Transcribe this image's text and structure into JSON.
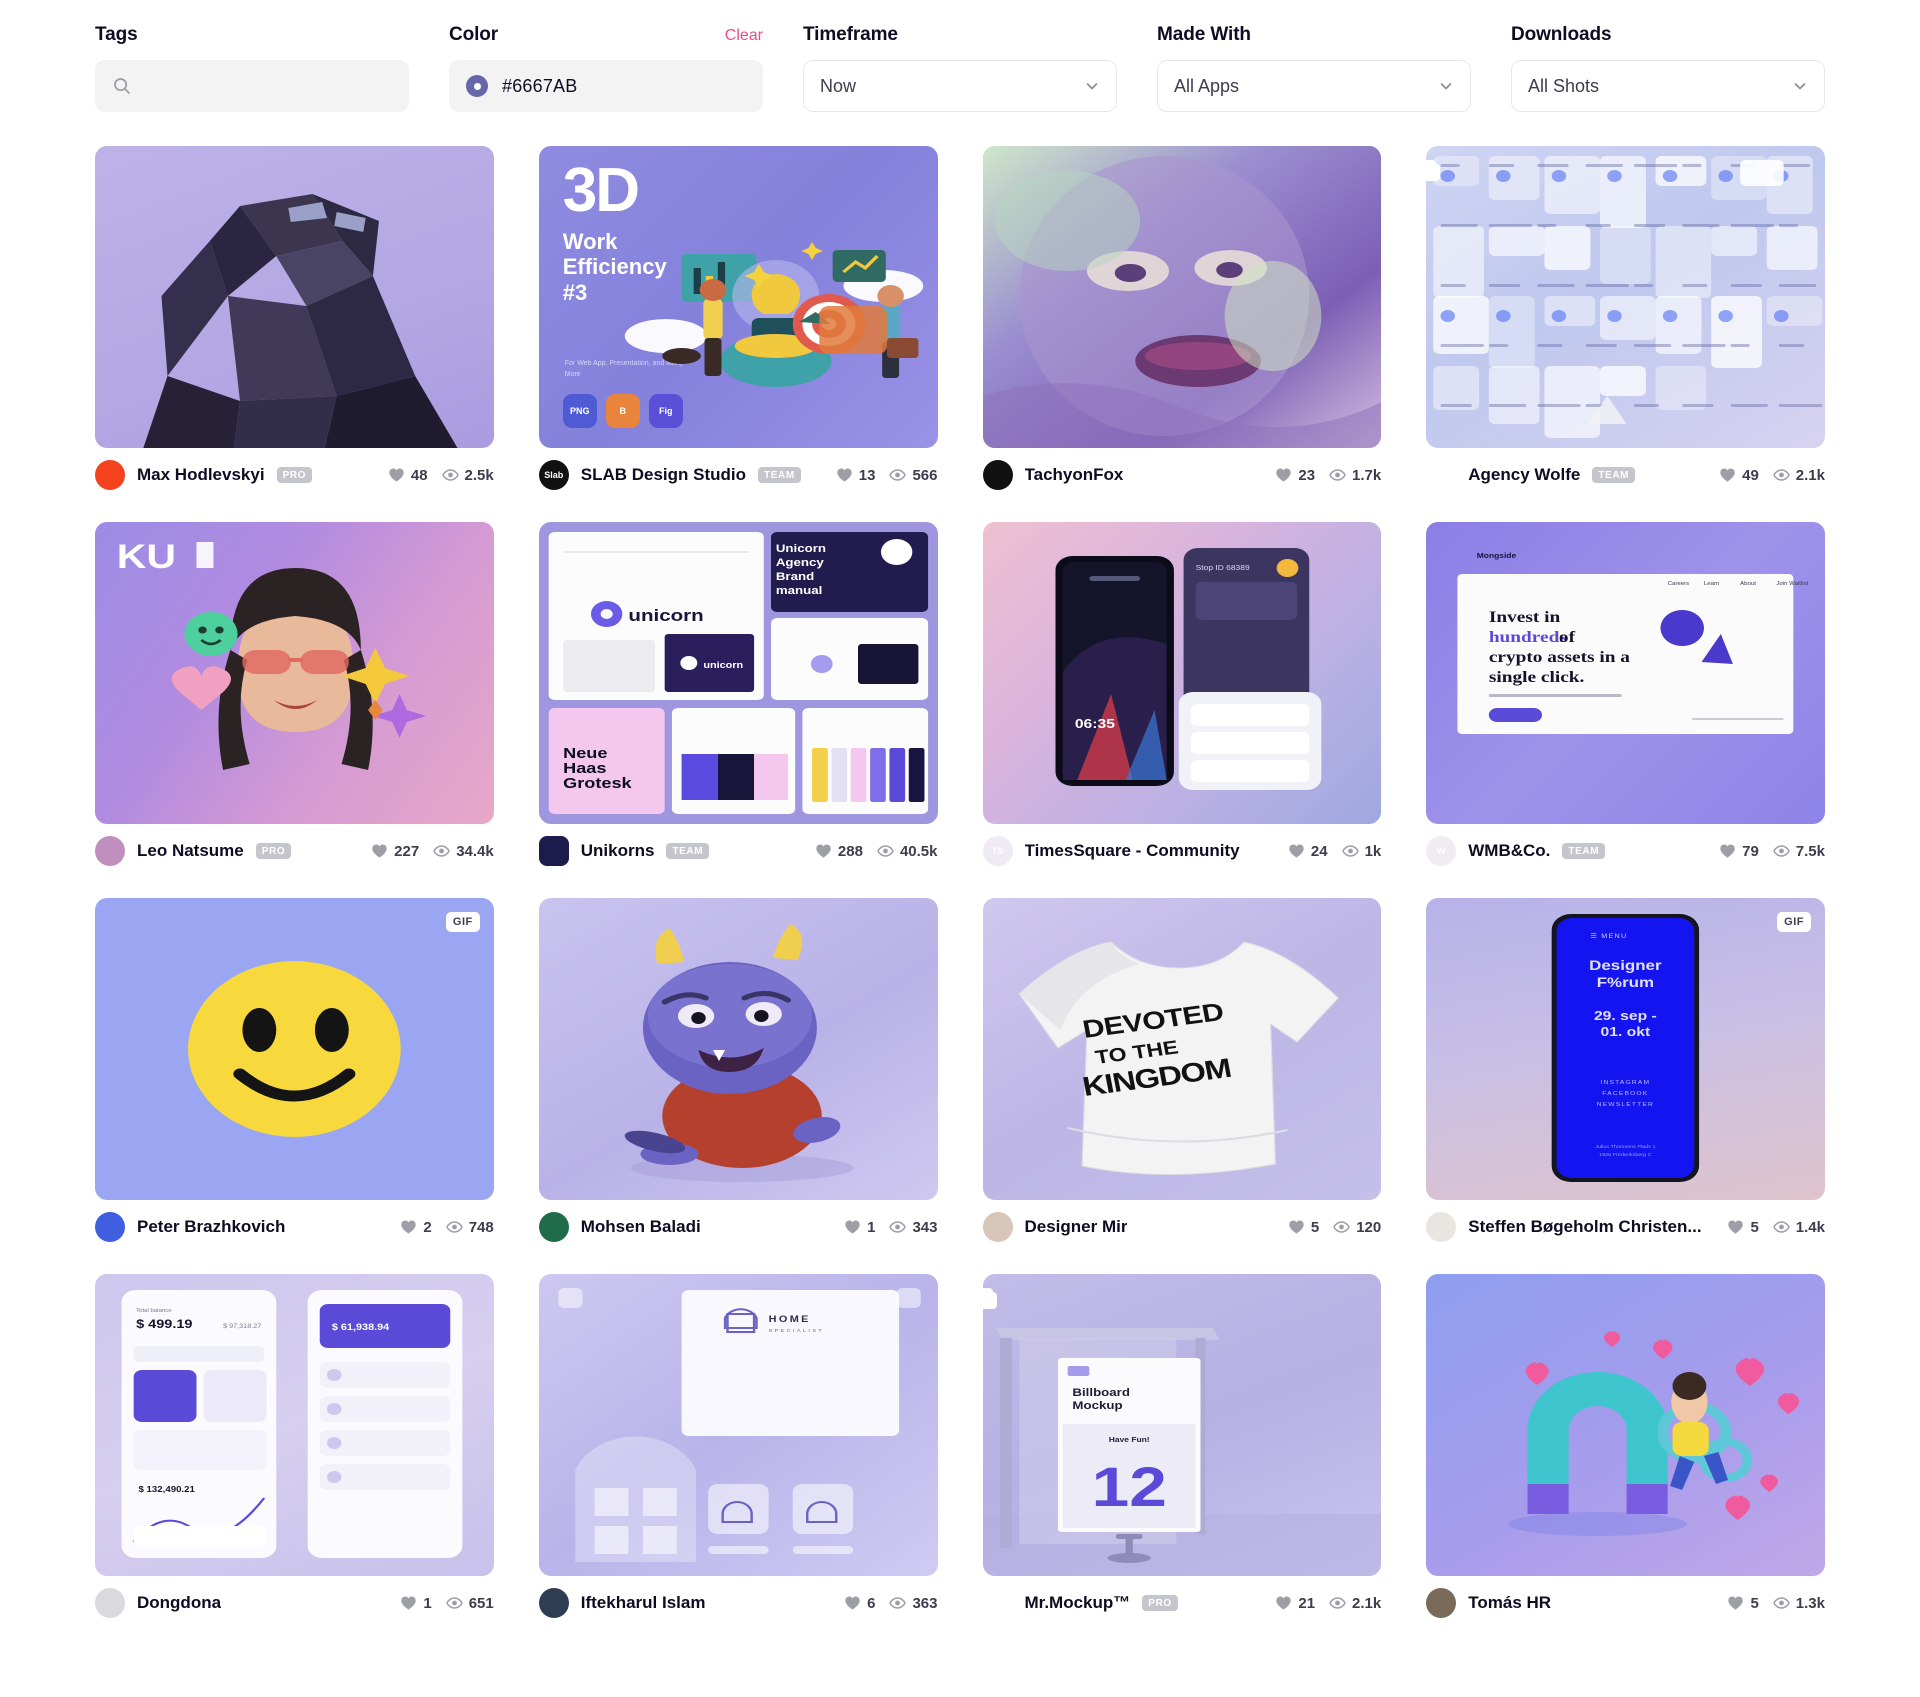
{
  "filters": [
    {
      "label": "Tags",
      "type": "search",
      "value": "",
      "placeholder": ""
    },
    {
      "label": "Color",
      "type": "color",
      "value": "#6667AB",
      "clear": "Clear",
      "swatch": "#6667AB"
    },
    {
      "label": "Timeframe",
      "type": "select",
      "value": "Now"
    },
    {
      "label": "Made With",
      "type": "select",
      "value": "All Apps"
    },
    {
      "label": "Downloads",
      "type": "select",
      "value": "All Shots"
    }
  ],
  "accent": {
    "pink": "#ea4c89",
    "ink": "#0d0c22",
    "muted": "#3d3d4e",
    "badge": "#c5c5cc"
  },
  "shots": [
    {
      "author": "Max Hodlevskyi",
      "badge": "PRO",
      "likes": "48",
      "views": "2.5k",
      "avatar_bg": "#f4411e",
      "avatar_text": "",
      "overlay": "",
      "art": "a-poly",
      "art_name": "low-poly-portrait-artwork"
    },
    {
      "author": "SLAB Design Studio",
      "badge": "TEAM",
      "likes": "13",
      "views": "566",
      "avatar_bg": "#111111",
      "avatar_text": "Slab",
      "overlay": "",
      "art": "a-3d",
      "art_name": "3d-work-efficiency-illustration",
      "art_text": {
        "big": "3D",
        "sub": "Work\nEfficiency\n#3",
        "caption": "For Web App, Presentation, and Many More",
        "apps": [
          "PNG",
          "B",
          "Fig"
        ]
      }
    },
    {
      "author": "TachyonFox",
      "badge": "",
      "likes": "23",
      "views": "1.7k",
      "avatar_bg": "#111111",
      "avatar_text": "",
      "overlay": "",
      "art": "a-face",
      "art_name": "glitch-portrait-artwork"
    },
    {
      "author": "Agency Wolfe",
      "badge": "TEAM",
      "likes": "49",
      "views": "2.1k",
      "avatar_bg": "transparent",
      "avatar_text": "",
      "overlay": "stack",
      "art": "a-kit",
      "art_name": "ui-kit-components-artwork"
    },
    {
      "author": "Leo Natsume",
      "badge": "PRO",
      "likes": "227",
      "views": "34.4k",
      "avatar_bg": "#c08fbd",
      "avatar_text": "",
      "overlay": "",
      "art": "a-ku",
      "art_name": "ku-3d-character-artwork",
      "art_text": {
        "logo": "KU"
      }
    },
    {
      "author": "Unikorns",
      "badge": "TEAM",
      "likes": "288",
      "views": "40.5k",
      "avatar_bg": "#1d1b4b",
      "avatar_text": "",
      "overlay": "",
      "art": "a-brand",
      "art_name": "unicorn-brand-manual-artwork",
      "art_text": {
        "brand": "unicorn",
        "manual": "Unicorn\nAgency\nBrand\nmanual",
        "type": "Neue\nHaas\nGrotesk"
      }
    },
    {
      "author": "TimesSquare - Community",
      "badge": "",
      "likes": "24",
      "views": "1k",
      "avatar_bg": "#efeaf3",
      "avatar_text": "TS",
      "overlay": "",
      "art": "a-ts",
      "art_name": "mobile-app-screens-artwork",
      "art_text": {
        "stop": "Stop ID 68389",
        "time": "06:35"
      }
    },
    {
      "author": "WMB&Co.",
      "badge": "TEAM",
      "likes": "79",
      "views": "7.5k",
      "avatar_bg": "#f0ecf2",
      "avatar_text": "W",
      "overlay": "",
      "art": "a-wmb",
      "art_name": "crypto-landing-page-artwork",
      "art_text": {
        "brand": "Mongside",
        "headline_1": "Invest in",
        "headline_2": "hundreds",
        "headline_3": "of",
        "headline_4": "crypto assets in a",
        "headline_5": "single click.",
        "nav": [
          "Careers",
          "Learn",
          "About",
          "Join Waitlist"
        ]
      }
    },
    {
      "author": "Peter Brazhkovich",
      "badge": "",
      "likes": "2",
      "views": "748",
      "avatar_bg": "#3f5fe0",
      "avatar_text": "",
      "overlay": "GIF",
      "art": "a-smiley",
      "art_name": "smiley-face-artwork"
    },
    {
      "author": "Mohsen Baladi",
      "badge": "",
      "likes": "1",
      "views": "343",
      "avatar_bg": "#1f6b4a",
      "avatar_text": "",
      "overlay": "",
      "art": "a-monster",
      "art_name": "3d-monster-character-artwork"
    },
    {
      "author": "Designer Mir",
      "badge": "",
      "likes": "5",
      "views": "120",
      "avatar_bg": "#d8c6b8",
      "avatar_text": "",
      "overlay": "",
      "art": "a-tshirt",
      "art_name": "tshirt-mockup-artwork",
      "art_text": {
        "line1": "DEVOTED",
        "line2": "TO THE",
        "line3": "KINGDOM"
      }
    },
    {
      "author": "Steffen Bøgeholm Christen...",
      "badge": "",
      "likes": "5",
      "views": "1.4k",
      "avatar_bg": "#e9e6e2",
      "avatar_text": "",
      "overlay": "GIF",
      "art": "a-phone",
      "art_name": "designer-forum-poster-artwork",
      "art_text": {
        "menu": "MENU",
        "title": "Designer\nF%rum",
        "dates": "29. sep -\n01. okt",
        "links": "INSTAGRAM\nFACEBOOK\nNEWSLETTER",
        "address": "Julius Thomsens Plads 1\n1925 Frederiksberg C"
      }
    },
    {
      "author": "Dongdona",
      "badge": "",
      "likes": "1",
      "views": "651",
      "avatar_bg": "#d9d9de",
      "avatar_text": "",
      "overlay": "",
      "art": "a-app",
      "art_name": "finance-app-screens-artwork",
      "art_text": {
        "balance": "$ 499.19",
        "portfolio": "$ 61,938.94"
      }
    },
    {
      "author": "Iftekharul Islam",
      "badge": "",
      "likes": "6",
      "views": "363",
      "avatar_bg": "#2f3d52",
      "avatar_text": "",
      "overlay": "",
      "art": "a-home",
      "art_name": "home-specialist-branding-artwork",
      "art_text": {
        "brand": "HOME",
        "sub": "SPECIALIST"
      }
    },
    {
      "author": "Mr.Mockup™",
      "badge": "PRO",
      "likes": "21",
      "views": "2.1k",
      "avatar_bg": "transparent",
      "avatar_text": "",
      "overlay": "stack",
      "art": "a-bill",
      "art_name": "billboard-mockup-artwork",
      "art_text": {
        "title": "Billboard\nMockup",
        "fun": "Have Fun!",
        "num": "12"
      }
    },
    {
      "author": "Tomás HR",
      "badge": "",
      "likes": "5",
      "views": "1.3k",
      "avatar_bg": "#7a6a5a",
      "avatar_text": "",
      "overlay": "",
      "art": "a-magnet",
      "art_name": "3d-magnet-hearts-artwork"
    }
  ]
}
